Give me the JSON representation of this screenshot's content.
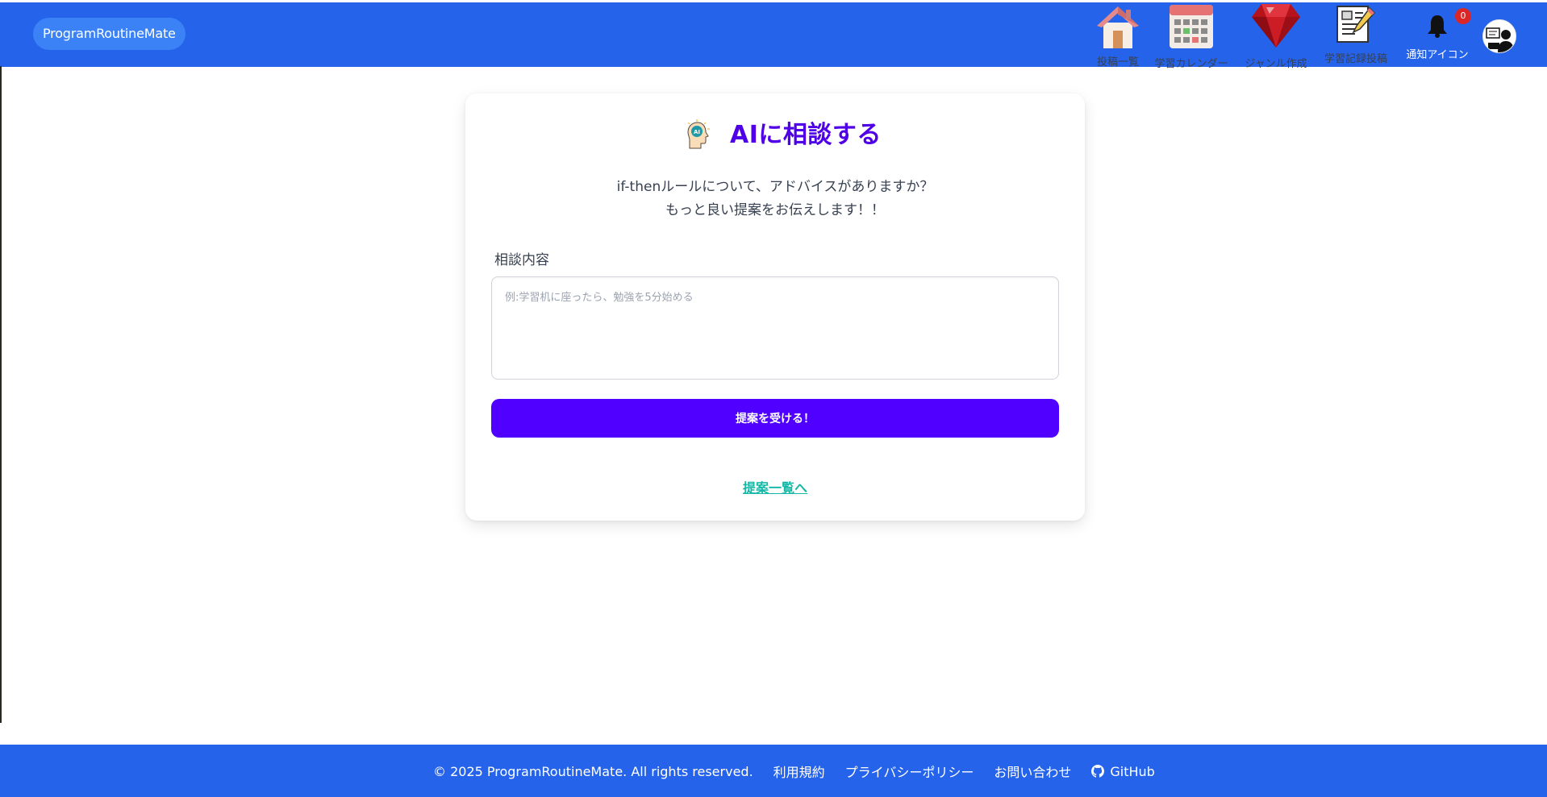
{
  "header": {
    "brand": "ProgramRoutineMate",
    "nav": [
      {
        "label": "投稿一覧",
        "icon": "house-icon"
      },
      {
        "label": "学習カレンダー",
        "icon": "calendar-icon"
      },
      {
        "label": "ジャンル作成",
        "icon": "ruby-gem-icon"
      },
      {
        "label": "学習記録投稿",
        "icon": "document-pencil-icon"
      },
      {
        "label": "通知アイコン",
        "icon": "bell-icon"
      }
    ],
    "notification_count": "0",
    "avatar_icon": "user-avatar-icon"
  },
  "main": {
    "title": "AIに相談する",
    "title_icon": "ai-head-icon",
    "desc_line1": "if-thenルールについて、アドバイスがありますか？",
    "desc_line2": "もっと良い提案をお伝えします！！",
    "field_label": "相談内容",
    "textarea_value": "",
    "textarea_placeholder": "例:学習机に座ったら、勉強を5分始める",
    "submit_label": "提案を受ける！",
    "link_label": "提案一覧へ"
  },
  "footer": {
    "copyright": "© 2025 ProgramRoutineMate. All rights reserved.",
    "links": [
      "利用規約",
      "プライバシーポリシー",
      "お問い合わせ"
    ],
    "github_label": "GitHub",
    "github_icon": "github-icon"
  },
  "colors": {
    "header_bg": "#2563eb",
    "brand_pill": "#3b82f6",
    "title": "#4f00e6",
    "button": "#4f00ff",
    "link": "#14b8a6",
    "badge": "#dc2626"
  }
}
